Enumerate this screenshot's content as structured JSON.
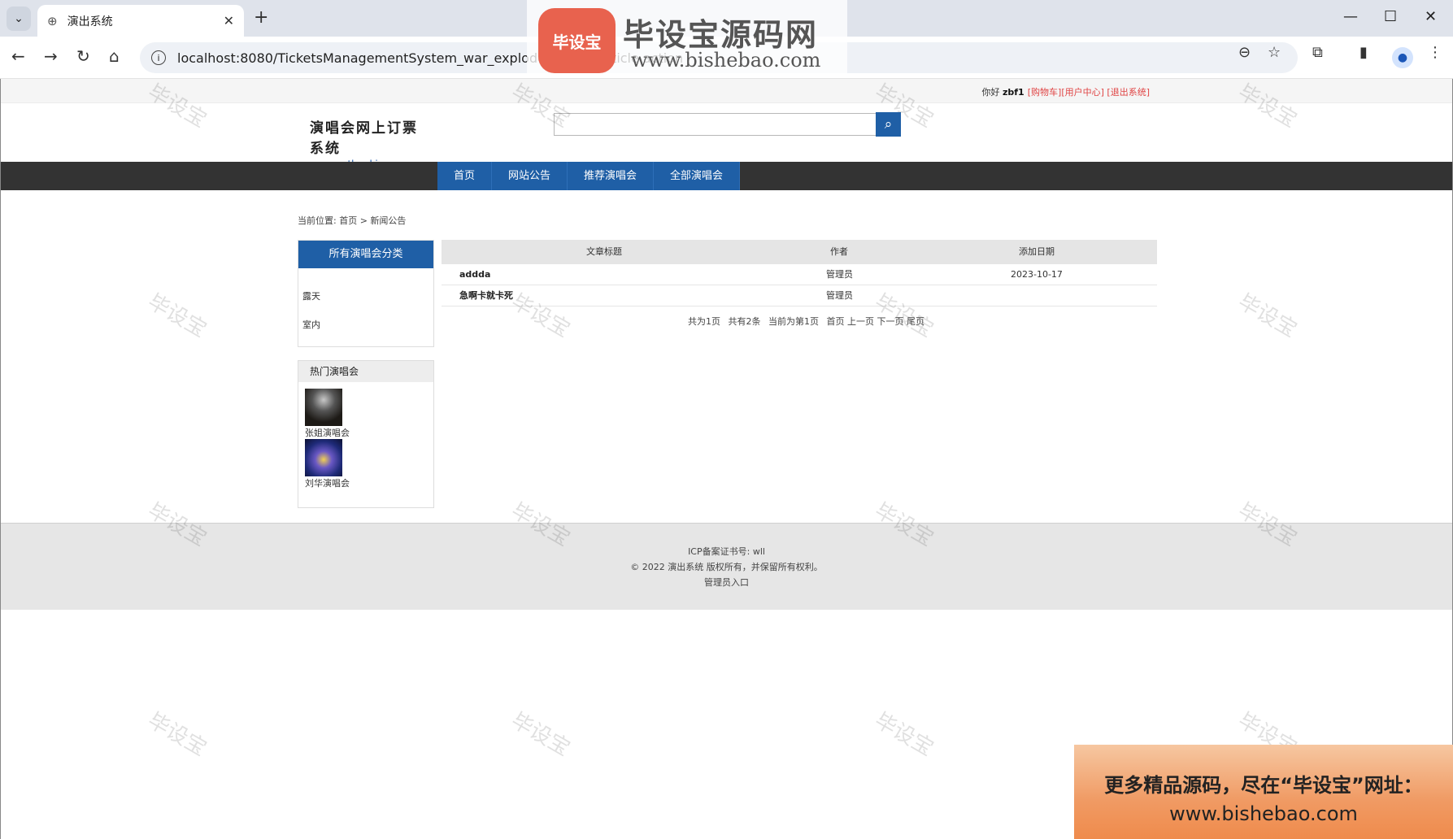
{
  "browser": {
    "tab_title": "演出系统",
    "url": "localhost:8080/TicketsManagementSystem_war_exploded/index/article.action"
  },
  "topbar": {
    "greeting": "你好",
    "username": "zbf1",
    "cart": "[购物车]",
    "user_center": "[用户中心]",
    "logout": "[退出系统]"
  },
  "header": {
    "logo_cn": "演唱会网上订票系统",
    "logo_en": "concertbooking.com",
    "search_placeholder": ""
  },
  "nav": {
    "items": [
      "首页",
      "网站公告",
      "推荐演唱会",
      "全部演唱会"
    ]
  },
  "breadcrumb": {
    "label": "当前位置:",
    "home": "首页",
    "sep": ">",
    "current": "新闻公告"
  },
  "sidebar": {
    "category_title": "所有演唱会分类",
    "categories": [
      "露天",
      "室内"
    ],
    "hot_title": "热门演唱会",
    "hot_items": [
      "张姐演唱会",
      "刘华演唱会"
    ]
  },
  "table": {
    "headers": [
      "文章标题",
      "作者",
      "添加日期"
    ],
    "rows": [
      {
        "title": "addda",
        "author": "管理员",
        "date": "2023-10-17"
      },
      {
        "title": "急啊卡就卡死",
        "author": "管理员",
        "date": ""
      }
    ]
  },
  "pager": {
    "total_pages": "共为1页",
    "total_items": "共有2条",
    "current": "当前为第1页",
    "first": "首页",
    "prev": "上一页",
    "next": "下一页",
    "last": "尾页"
  },
  "footer": {
    "icp": "ICP备案证书号: wll",
    "copyright": "© 2022 演出系统 版权所有，并保留所有权利。",
    "admin": "管理员入口"
  },
  "overlay": {
    "watermark": "毕设宝",
    "brand_badge": "毕设宝",
    "brand_name": "毕设宝源码网",
    "brand_url": "www.bishebao.com",
    "promo_line1": "更多精品源码，尽在“毕设宝”网址：",
    "promo_line2": "www.bishebao.com"
  }
}
